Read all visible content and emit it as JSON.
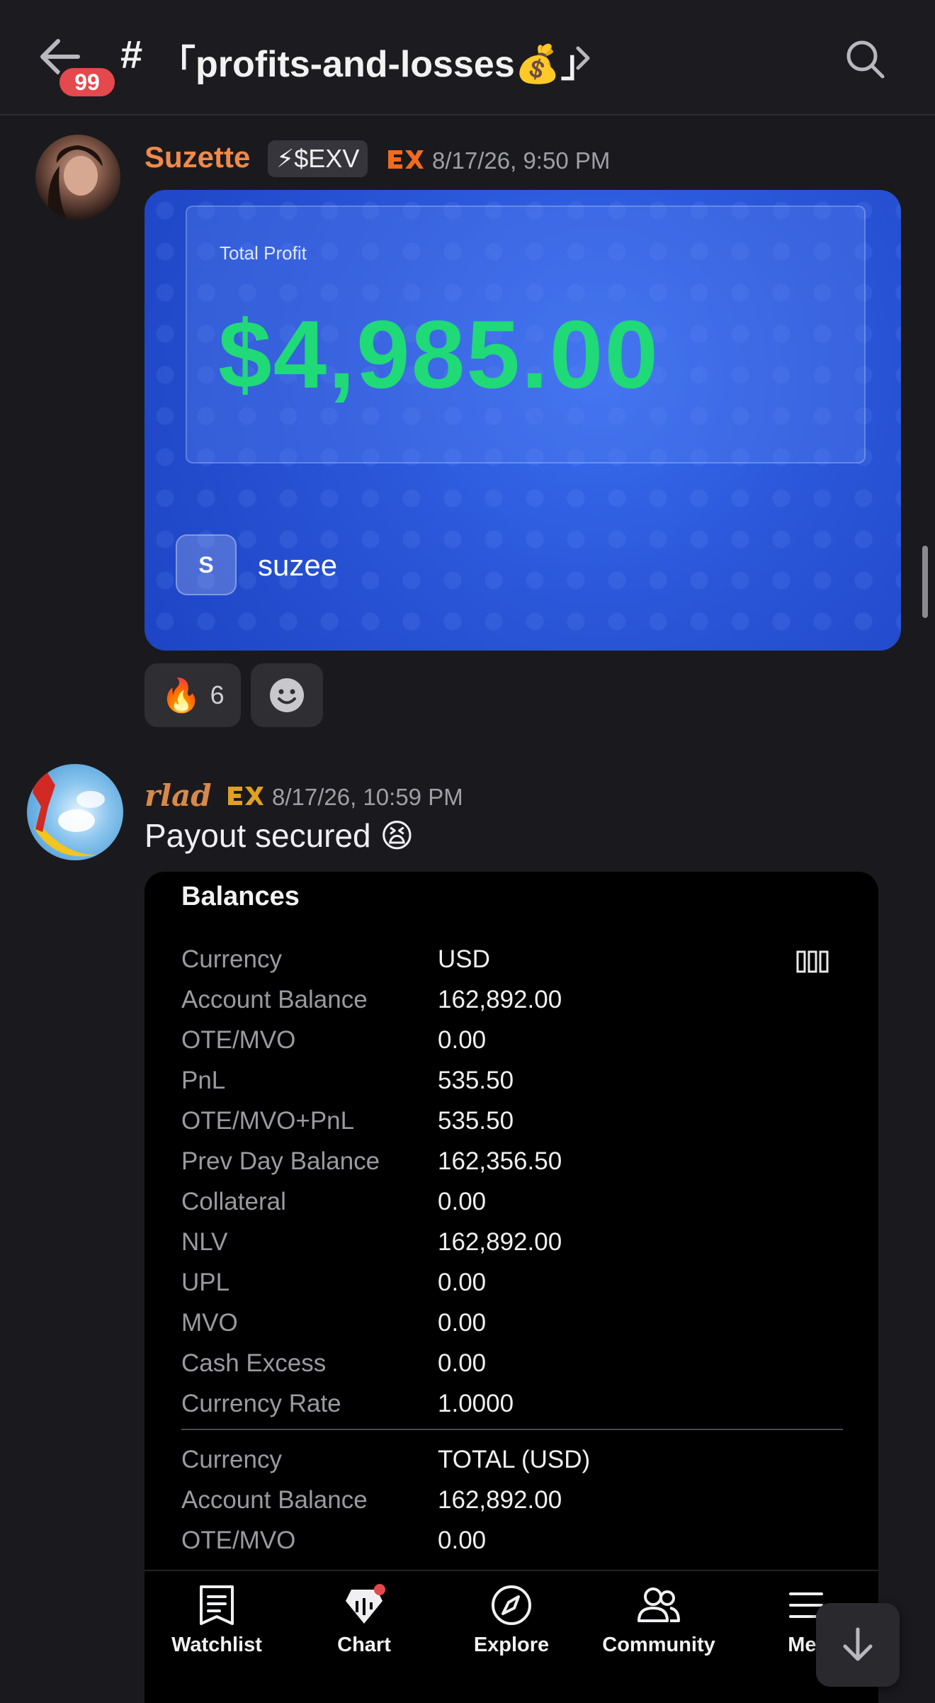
{
  "header": {
    "unread_count": "99",
    "channel_hash": "#",
    "channel_name": "「profits-and-losses💰」"
  },
  "messages": [
    {
      "username": "Suzette",
      "username_color": "#f0894a",
      "role_tag": "⚡$EXV",
      "timestamp": "8/17/26, 9:50 PM",
      "card": {
        "label": "Total Profit",
        "amount": "$4,985.00",
        "user_initial": "S",
        "user_name": "suzee"
      },
      "reactions": [
        {
          "emoji": "🔥",
          "count": "6"
        }
      ]
    },
    {
      "username": "rlad",
      "username_color": "#d8894a",
      "timestamp": "8/17/26, 10:59 PM",
      "text": "Payout secured 😫",
      "balances": {
        "title": "Balances",
        "rows": [
          {
            "k": "Currency",
            "v": "USD"
          },
          {
            "k": "Account Balance",
            "v": "162,892.00"
          },
          {
            "k": "OTE/MVO",
            "v": "0.00"
          },
          {
            "k": "PnL",
            "v": "535.50"
          },
          {
            "k": "OTE/MVO+PnL",
            "v": "535.50"
          },
          {
            "k": "Prev Day Balance",
            "v": "162,356.50"
          },
          {
            "k": "Collateral",
            "v": "0.00"
          },
          {
            "k": "NLV",
            "v": "162,892.00"
          },
          {
            "k": "UPL",
            "v": "0.00"
          },
          {
            "k": "MVO",
            "v": "0.00"
          },
          {
            "k": "Cash Excess",
            "v": "0.00"
          },
          {
            "k": "Currency Rate",
            "v": "1.0000"
          }
        ],
        "rows2": [
          {
            "k": "Currency",
            "v": "TOTAL (USD)"
          },
          {
            "k": "Account Balance",
            "v": "162,892.00"
          },
          {
            "k": "OTE/MVO",
            "v": "0.00"
          }
        ]
      }
    }
  ],
  "bottom_nav": [
    {
      "label": "Watchlist",
      "icon": "watchlist-icon"
    },
    {
      "label": "Chart",
      "icon": "chart-icon"
    },
    {
      "label": "Explore",
      "icon": "compass-icon"
    },
    {
      "label": "Community",
      "icon": "community-icon"
    },
    {
      "label": "Mer",
      "icon": "menu-icon"
    }
  ],
  "colors": {
    "profit_green": "#20d977",
    "card_blue": "#2a56d8",
    "badge_red": "#e5484d"
  }
}
